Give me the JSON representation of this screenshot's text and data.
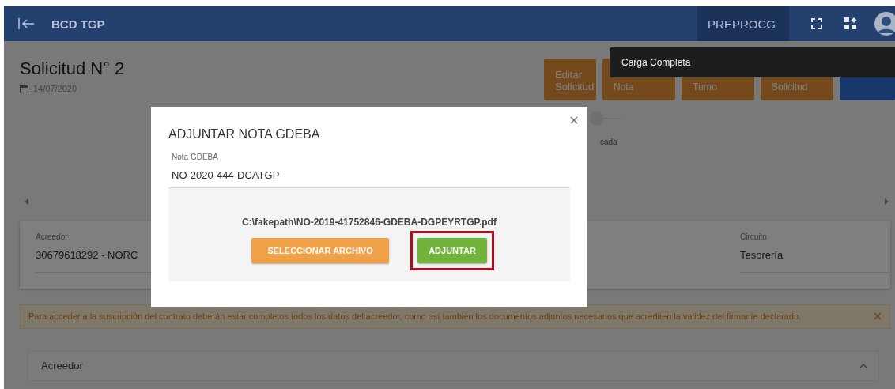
{
  "header": {
    "app_title": "BCD **TGP**",
    "environment": "PREPROCG"
  },
  "page": {
    "title": "Solicitud N° 2",
    "date": "14/07/2020"
  },
  "actions": [
    {
      "label": "Editar Solicitud",
      "kind": "warning"
    },
    {
      "label": "Nota",
      "kind": "warning"
    },
    {
      "label": "Turno",
      "kind": "warning"
    },
    {
      "label": "Solicitud",
      "kind": "warning"
    },
    {
      "kind": "info"
    }
  ],
  "toast": {
    "message": "Carga Completa"
  },
  "stepper": {
    "label": "cada"
  },
  "summary": {
    "fields": [
      {
        "label": "Acreedor",
        "value": "30679618292 - NORC"
      },
      {
        "label": "Circuito",
        "value": "Tesorería"
      }
    ]
  },
  "alert": {
    "message": "Para acceder a la suscripción del contrato deberán estar completos todos los datos del acreedor, como así también los documentos adjuntos necesarios que acrediten la validez del firmante declarado."
  },
  "sections": [
    {
      "title": "Acreedor",
      "expanded": true
    }
  ],
  "modal": {
    "title": "ADJUNTAR NOTA GDEBA",
    "field": {
      "label": "Nota GDEBA",
      "value": "NO-2020-444-DCATGP"
    },
    "file_name": "C:\\fakepath\\NO-2019-41752846-GDEBA-DGPEYRTGP.pdf",
    "buttons": [
      {
        "label": "SELECCIONAR ARCHIVO",
        "kind": "secondary",
        "highlighted": false
      },
      {
        "label": "ADJUNTAR",
        "kind": "primary",
        "highlighted": true
      }
    ]
  }
}
